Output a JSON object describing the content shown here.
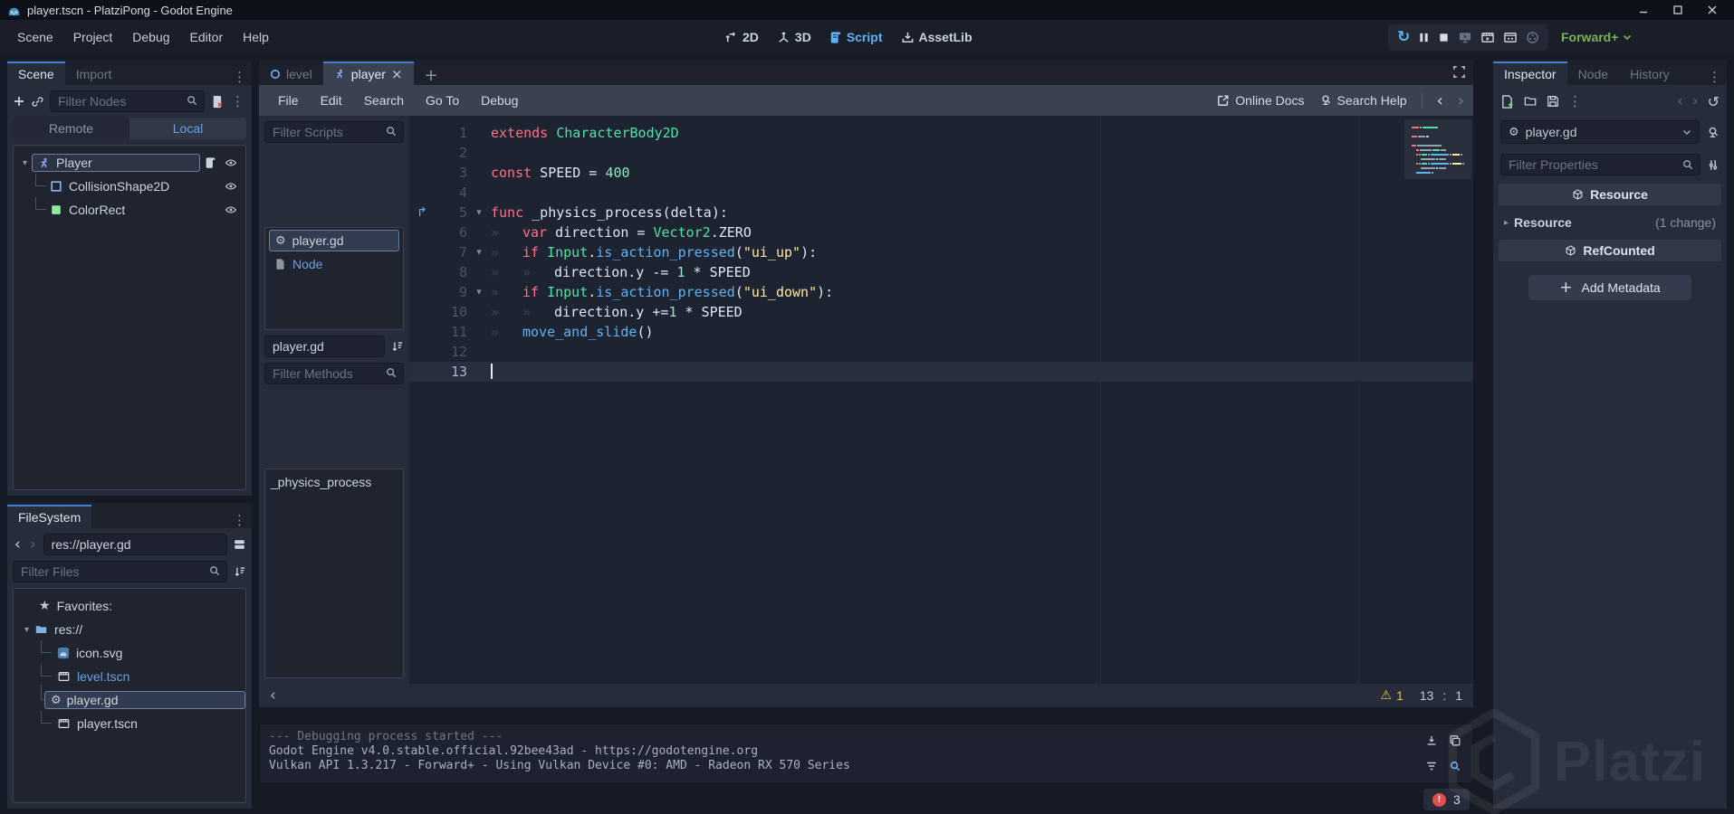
{
  "window": {
    "title": "player.tscn - PlatziPong - Godot Engine"
  },
  "menubar": {
    "items": [
      "Scene",
      "Project",
      "Debug",
      "Editor",
      "Help"
    ]
  },
  "workspace_switcher": {
    "items": [
      "2D",
      "3D",
      "Script",
      "AssetLib"
    ]
  },
  "run_toolbar": {
    "renderer": "Forward+"
  },
  "scene_dock": {
    "tabs": [
      "Scene",
      "Import"
    ],
    "filter_placeholder": "Filter Nodes",
    "remote_label": "Remote",
    "local_label": "Local",
    "nodes": [
      "Player",
      "CollisionShape2D",
      "ColorRect"
    ]
  },
  "filesystem_dock": {
    "title": "FileSystem",
    "path": "res://player.gd",
    "filter_placeholder": "Filter Files",
    "favorites_label": "Favorites:",
    "root_label": "res://",
    "files": [
      "icon.svg",
      "level.tscn",
      "player.gd",
      "player.tscn"
    ]
  },
  "script_editor": {
    "scene_tabs": [
      "level",
      "player"
    ],
    "menus": [
      "File",
      "Edit",
      "Search",
      "Go To",
      "Debug"
    ],
    "online_docs": "Online Docs",
    "search_help": "Search Help",
    "filter_scripts_placeholder": "Filter Scripts",
    "scripts": [
      "player.gd",
      "Node"
    ],
    "script_name_value": "player.gd",
    "filter_methods_placeholder": "Filter Methods",
    "methods": [
      "_physics_process"
    ],
    "status": {
      "warnings": "1",
      "line": "13",
      "sep": ":",
      "col": "1"
    }
  },
  "code": {
    "lines": [
      {
        "n": "1",
        "tokens": [
          [
            "kw",
            "extends"
          ],
          [
            "pl",
            " "
          ],
          [
            "ty",
            "CharacterBody2D"
          ]
        ]
      },
      {
        "n": "2",
        "tokens": []
      },
      {
        "n": "3",
        "tokens": [
          [
            "kw",
            "const"
          ],
          [
            "pl",
            " SPEED = "
          ],
          [
            "nu",
            "400"
          ]
        ]
      },
      {
        "n": "4",
        "tokens": []
      },
      {
        "n": "5",
        "fold": true,
        "override": true,
        "tokens": [
          [
            "kw",
            "func"
          ],
          [
            "pl",
            " _physics_process(delta):"
          ]
        ]
      },
      {
        "n": "6",
        "tokens": [
          [
            "tab",
            ""
          ],
          [
            "kw",
            "var"
          ],
          [
            "pl",
            " direction = "
          ],
          [
            "ty",
            "Vector2"
          ],
          [
            "pl",
            ".ZERO"
          ]
        ]
      },
      {
        "n": "7",
        "fold": true,
        "tokens": [
          [
            "tab",
            ""
          ],
          [
            "kw",
            "if"
          ],
          [
            "pl",
            " "
          ],
          [
            "ty",
            "Input"
          ],
          [
            "pl",
            "."
          ],
          [
            "fn",
            "is_action_pressed"
          ],
          [
            "pl",
            "("
          ],
          [
            "st",
            "\"ui_up\""
          ],
          [
            "pl",
            "):"
          ]
        ]
      },
      {
        "n": "8",
        "tokens": [
          [
            "tab",
            ""
          ],
          [
            "tab",
            ""
          ],
          [
            "pl",
            "direction.y -= "
          ],
          [
            "nu",
            "1"
          ],
          [
            "pl",
            " * SPEED"
          ]
        ]
      },
      {
        "n": "9",
        "fold": true,
        "tokens": [
          [
            "tab",
            ""
          ],
          [
            "kw",
            "if"
          ],
          [
            "pl",
            " "
          ],
          [
            "ty",
            "Input"
          ],
          [
            "pl",
            "."
          ],
          [
            "fn",
            "is_action_pressed"
          ],
          [
            "pl",
            "("
          ],
          [
            "st",
            "\"ui_down\""
          ],
          [
            "pl",
            "):"
          ]
        ]
      },
      {
        "n": "10",
        "tokens": [
          [
            "tab",
            ""
          ],
          [
            "tab",
            ""
          ],
          [
            "pl",
            "direction.y +="
          ],
          [
            "nu",
            "1"
          ],
          [
            "pl",
            " * SPEED"
          ]
        ]
      },
      {
        "n": "11",
        "tokens": [
          [
            "tab",
            ""
          ],
          [
            "fn",
            "move_and_slide"
          ],
          [
            "pl",
            "()"
          ]
        ]
      },
      {
        "n": "12",
        "tokens": []
      },
      {
        "n": "13",
        "current": true,
        "caret": true,
        "tokens": []
      }
    ]
  },
  "inspector": {
    "tabs": [
      "Inspector",
      "Node",
      "History"
    ],
    "object_name": "player.gd",
    "filter_placeholder": "Filter Properties",
    "resource_header": "Resource",
    "resource_row": "Resource",
    "resource_badge": "(1 change)",
    "refcounted_header": "RefCounted",
    "add_metadata_label": "Add Metadata"
  },
  "output": {
    "lines": [
      "--- Debugging process started ---",
      "Godot Engine v4.0.stable.official.92bee43ad - https://godotengine.org",
      "Vulkan API 1.3.217 - Forward+ - Using Vulkan Device #0: AMD - Radeon RX 570 Series"
    ],
    "error_count": "3"
  },
  "watermark": {
    "text": "Platzi"
  },
  "colors": {
    "accent_blue": "#477fd3",
    "link_blue": "#6d9fe4",
    "keyword": "#ff7085",
    "engine_type": "#4fe0a8",
    "number": "#8fe8c0",
    "string": "#ffe79e",
    "function_call": "#5fb2f2",
    "renderer_green": "#7bb254",
    "warning": "#dfc050",
    "error": "#e04f4f"
  }
}
